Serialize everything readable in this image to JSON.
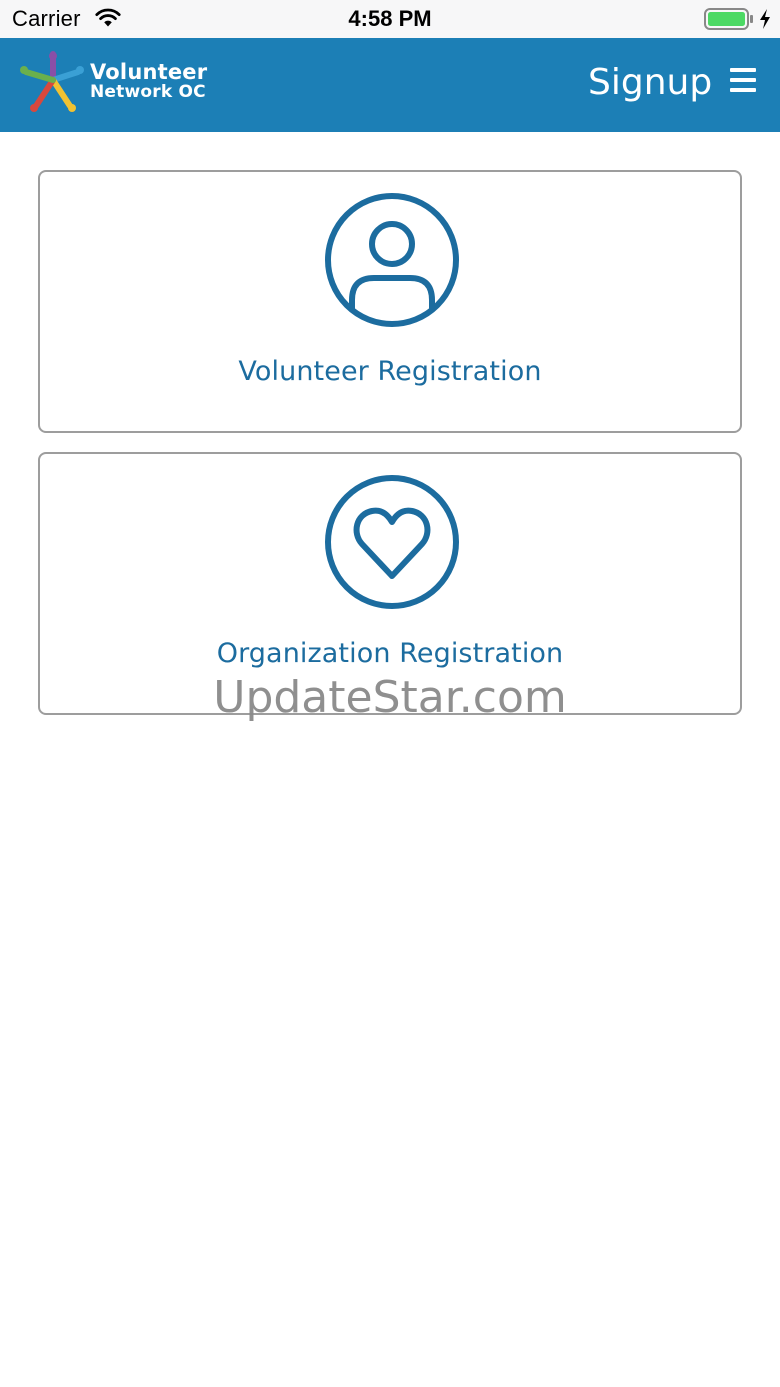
{
  "status_bar": {
    "carrier": "Carrier",
    "time": "4:58 PM",
    "wifi_icon": "wifi-icon",
    "battery_icon": "battery-icon",
    "charging_icon": "lightning-bolt-icon",
    "battery_color": "#4cd964"
  },
  "header": {
    "logo_line1": "Volunteer",
    "logo_line2": "Network OC",
    "title": "Signup",
    "menu_icon": "hamburger-menu-icon",
    "background_color": "#1c7fb6"
  },
  "options": [
    {
      "label": "Volunteer Registration",
      "icon": "user-circle-icon"
    },
    {
      "label": "Organization Registration",
      "icon": "heart-circle-icon"
    }
  ],
  "accent_color": "#1c6c9f",
  "watermark": "UpdateStar.com"
}
